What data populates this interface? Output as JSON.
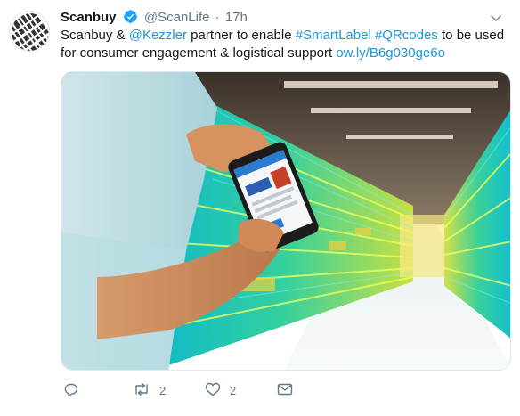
{
  "tweet": {
    "author_name": "Scanbuy",
    "handle": "@ScanLife",
    "separator": "·",
    "time": "17h",
    "text_parts": {
      "t1": "Scanbuy & ",
      "mention": "@Kezzler",
      "t2": " partner to enable ",
      "hashtag1": "#SmartLabel",
      "t3": " ",
      "hashtag2": "#QRcodes",
      "t4": " to be used for consumer engagement & logistical support ",
      "link": "ow.ly/B6g030ge6o"
    }
  },
  "actions": {
    "reply_count": "",
    "retweet_count": "2",
    "like_count": "2"
  },
  "colors": {
    "link": "#1b95e0",
    "secondary": "#657786",
    "verified": "#1da1f2"
  },
  "icons": [
    "scanbuy-logo-icon",
    "verified-badge-icon",
    "caret-down-icon",
    "reply-icon",
    "retweet-icon",
    "like-icon",
    "dm-icon"
  ]
}
